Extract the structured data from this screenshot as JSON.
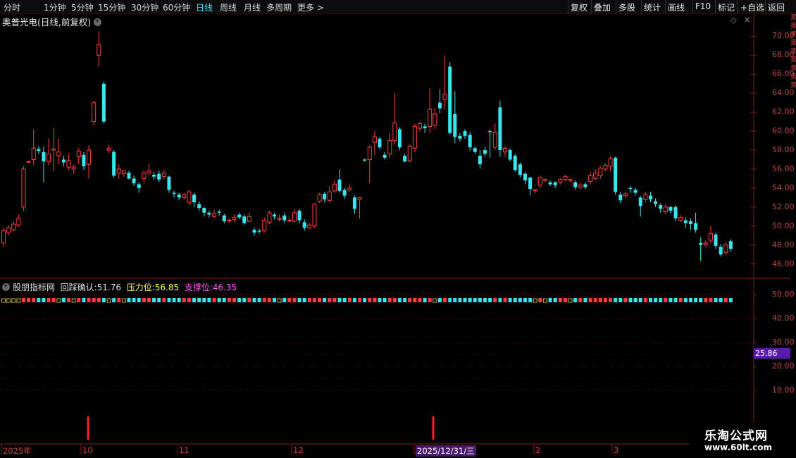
{
  "toolbar": {
    "timeframes": [
      "分时",
      "1分钟",
      "5分钟",
      "15分钟",
      "30分钟",
      "60分钟",
      "日线",
      "周线",
      "月线",
      "多周期",
      "更多 >"
    ],
    "active_index": 6,
    "right_buttons": [
      "复权",
      "叠加",
      "多股",
      "统计",
      "画线",
      "F10",
      "标记",
      "+自选",
      "返回"
    ]
  },
  "main_chart": {
    "title": "奥普光电(日线,前复权)",
    "y_ticks": [
      "70.00",
      "68.00",
      "66.00",
      "64.00",
      "62.00",
      "60.00",
      "58.00",
      "56.00",
      "54.00",
      "52.00",
      "50.00",
      "48.00",
      "46.00"
    ],
    "y_min": 45.0,
    "y_max": 71.0
  },
  "indicator": {
    "name": "股朋指标网",
    "items": [
      {
        "label": "回踩确认:",
        "value": "51.76",
        "color": "#dcdcdc"
      },
      {
        "label": "压力位:",
        "value": "56.85",
        "color": "#ffff55"
      },
      {
        "label": "支撑位:",
        "value": "46.35",
        "color": "#ff55ff"
      }
    ],
    "y_ticks": [
      "50.00",
      "40.00",
      "30.00",
      "20.00",
      "10.00"
    ],
    "current_value_tag": "25.86"
  },
  "x_axis": {
    "labels": [
      "2025年",
      "10",
      "11",
      "12",
      "2025/12/31/三",
      "2",
      "3"
    ],
    "highlight_index": 4
  },
  "watermark": {
    "line1": "乐淘公式网",
    "line2": "www.60lt.com"
  },
  "right_strip_text": "奥奥奥奥奥奥奥奥奥",
  "chart_data": {
    "type": "candlestick",
    "title": "奥普光电(日线,前复权)",
    "ylim": [
      45.0,
      71.0
    ],
    "candles": [
      [
        48.2,
        49.5,
        47.8,
        49.8
      ],
      [
        49.3,
        49.8,
        49.0,
        50.1
      ],
      [
        49.6,
        50.2,
        49.4,
        50.5
      ],
      [
        50.1,
        50.8,
        49.9,
        51.2
      ],
      [
        52.0,
        56.0,
        51.6,
        56.3
      ],
      [
        56.8,
        56.8,
        56.6,
        56.9
      ],
      [
        57.0,
        58.2,
        56.4,
        60.2
      ],
      [
        58.1,
        57.9,
        57.6,
        58.4
      ],
      [
        57.8,
        56.8,
        54.6,
        58.4
      ],
      [
        56.8,
        57.6,
        56.4,
        59.2
      ],
      [
        58.0,
        58.1,
        55.8,
        60.3
      ],
      [
        57.4,
        57.8,
        56.5,
        59.2
      ],
      [
        57.0,
        56.7,
        56.3,
        57.4
      ],
      [
        56.2,
        56.9,
        55.9,
        57.6
      ],
      [
        56.0,
        56.2,
        55.5,
        56.5
      ],
      [
        57.3,
        57.9,
        56.5,
        58.2
      ],
      [
        57.5,
        56.3,
        55.9,
        57.8
      ],
      [
        56.5,
        58.0,
        55.0,
        58.5
      ],
      [
        61.0,
        63.0,
        60.6,
        63.2
      ],
      [
        68.0,
        69.1,
        66.8,
        70.5
      ],
      [
        65.0,
        61.0,
        60.8,
        65.2
      ],
      [
        58.0,
        58.2,
        57.7,
        58.6
      ],
      [
        57.8,
        55.3,
        55.1,
        58.0
      ],
      [
        55.6,
        56.0,
        55.0,
        56.5
      ],
      [
        55.5,
        55.8,
        55.2,
        55.9
      ],
      [
        55.6,
        55.0,
        54.9,
        55.8
      ],
      [
        55.0,
        54.5,
        54.2,
        55.3
      ],
      [
        54.4,
        54.0,
        53.5,
        54.6
      ],
      [
        55.0,
        55.6,
        54.5,
        55.8
      ],
      [
        55.6,
        55.8,
        55.3,
        56.6
      ],
      [
        55.4,
        55.2,
        54.9,
        55.7
      ],
      [
        55.5,
        54.9,
        54.6,
        55.8
      ],
      [
        55.2,
        55.6,
        54.9,
        55.9
      ],
      [
        55.2,
        53.8,
        53.5,
        55.3
      ],
      [
        53.5,
        53.4,
        53.0,
        53.7
      ],
      [
        53.3,
        53.0,
        52.7,
        53.5
      ],
      [
        53.0,
        53.3,
        52.8,
        53.5
      ],
      [
        52.5,
        53.6,
        52.2,
        53.8
      ],
      [
        53.3,
        52.5,
        52.0,
        53.5
      ],
      [
        52.3,
        51.9,
        51.6,
        52.6
      ],
      [
        51.9,
        51.4,
        51.0,
        52.0
      ],
      [
        51.4,
        51.2,
        50.9,
        51.6
      ],
      [
        51.0,
        51.3,
        50.8,
        51.7
      ],
      [
        51.5,
        51.4,
        51.1,
        51.7
      ],
      [
        51.1,
        50.5,
        50.3,
        51.3
      ],
      [
        50.6,
        50.6,
        50.3,
        50.8
      ],
      [
        50.7,
        50.9,
        50.4,
        51.2
      ],
      [
        51.2,
        50.9,
        50.7,
        51.4
      ],
      [
        51.0,
        50.3,
        50.1,
        51.2
      ],
      [
        50.5,
        51.0,
        50.4,
        51.4
      ],
      [
        49.6,
        49.3,
        49.0,
        49.8
      ],
      [
        49.5,
        49.4,
        49.2,
        49.7
      ],
      [
        49.5,
        50.6,
        49.3,
        50.9
      ],
      [
        50.4,
        51.4,
        50.2,
        51.6
      ],
      [
        51.2,
        51.0,
        50.7,
        51.4
      ],
      [
        50.7,
        50.8,
        50.5,
        51.2
      ],
      [
        51.1,
        50.6,
        50.3,
        51.4
      ],
      [
        50.6,
        50.6,
        50.4,
        50.9
      ],
      [
        50.5,
        51.4,
        50.3,
        51.8
      ],
      [
        51.6,
        50.6,
        50.3,
        51.8
      ],
      [
        50.4,
        49.8,
        49.5,
        50.7
      ],
      [
        49.8,
        50.1,
        49.7,
        50.3
      ],
      [
        50.0,
        52.3,
        49.8,
        52.4
      ],
      [
        52.6,
        53.3,
        52.4,
        53.5
      ],
      [
        53.4,
        52.8,
        52.5,
        53.6
      ],
      [
        52.7,
        53.6,
        52.5,
        54.2
      ],
      [
        53.7,
        54.4,
        53.5,
        54.8
      ],
      [
        54.9,
        53.7,
        53.5,
        56.0
      ],
      [
        53.8,
        53.2,
        52.9,
        54.0
      ],
      [
        53.8,
        54.0,
        53.6,
        54.4
      ],
      [
        53.0,
        51.8,
        51.3,
        53.2
      ],
      [
        52.8,
        53.0,
        50.8,
        53.0
      ],
      [
        57.0,
        56.9,
        56.8,
        57.1
      ],
      [
        57.0,
        58.3,
        54.5,
        58.5
      ],
      [
        58.8,
        59.4,
        57.5,
        60.0
      ],
      [
        59.2,
        58.3,
        58.1,
        59.4
      ],
      [
        57.5,
        57.2,
        57.0,
        57.8
      ],
      [
        57.6,
        59.0,
        57.2,
        59.8
      ],
      [
        59.0,
        60.9,
        58.6,
        64.0
      ],
      [
        60.2,
        58.3,
        58.0,
        60.4
      ],
      [
        57.4,
        56.8,
        56.7,
        57.6
      ],
      [
        56.9,
        58.4,
        56.7,
        58.6
      ],
      [
        58.2,
        60.5,
        57.8,
        60.8
      ],
      [
        60.3,
        60.8,
        60.0,
        61.0
      ],
      [
        60.5,
        60.3,
        59.8,
        60.8
      ],
      [
        60.5,
        62.3,
        59.8,
        64.5
      ],
      [
        60.6,
        61.8,
        60.2,
        62.4
      ],
      [
        63.0,
        62.4,
        61.9,
        64.4
      ],
      [
        63.3,
        63.9,
        62.3,
        68.0
      ],
      [
        66.8,
        59.8,
        59.6,
        67.3
      ],
      [
        61.8,
        59.4,
        58.7,
        64.2
      ],
      [
        59.5,
        59.2,
        58.9,
        59.8
      ],
      [
        60.0,
        59.5,
        59.2,
        60.2
      ],
      [
        59.6,
        58.3,
        57.9,
        59.9
      ],
      [
        58.2,
        57.8,
        57.6,
        58.4
      ],
      [
        57.4,
        56.5,
        56.1,
        58.0
      ],
      [
        58.0,
        57.6,
        57.3,
        58.3
      ],
      [
        60.0,
        59.9,
        57.2,
        60.2
      ],
      [
        58.3,
        59.9,
        58.0,
        60.8
      ],
      [
        62.5,
        58.0,
        57.3,
        63.2
      ],
      [
        57.8,
        58.2,
        57.3,
        58.4
      ],
      [
        58.0,
        57.0,
        56.8,
        58.2
      ],
      [
        57.4,
        55.9,
        55.7,
        57.6
      ],
      [
        56.5,
        55.4,
        55.1,
        56.7
      ],
      [
        55.5,
        54.8,
        54.4,
        55.7
      ],
      [
        55.1,
        53.9,
        53.2,
        55.2
      ],
      [
        53.7,
        53.8,
        53.4,
        53.9
      ],
      [
        54.3,
        55.1,
        54.0,
        55.3
      ],
      [
        54.8,
        54.9,
        54.6,
        55.0
      ],
      [
        54.6,
        54.4,
        54.2,
        54.8
      ],
      [
        54.6,
        54.3,
        54.0,
        54.7
      ],
      [
        54.6,
        54.9,
        54.4,
        55.1
      ],
      [
        54.9,
        55.2,
        54.7,
        55.4
      ],
      [
        54.8,
        54.9,
        54.6,
        55.0
      ],
      [
        54.6,
        54.1,
        53.8,
        54.8
      ],
      [
        54.1,
        54.3,
        53.9,
        54.6
      ],
      [
        54.4,
        54.1,
        53.9,
        54.6
      ],
      [
        54.7,
        55.3,
        54.4,
        55.7
      ],
      [
        55.0,
        55.6,
        54.8,
        56.0
      ],
      [
        55.3,
        56.1,
        55.0,
        56.3
      ],
      [
        56.0,
        56.4,
        55.8,
        56.6
      ],
      [
        56.3,
        57.1,
        55.8,
        57.4
      ],
      [
        57.2,
        53.6,
        53.3,
        57.3
      ],
      [
        53.3,
        52.7,
        52.4,
        53.6
      ],
      [
        53.2,
        53.4,
        52.9,
        53.6
      ],
      [
        54.0,
        53.9,
        53.5,
        54.2
      ],
      [
        53.8,
        53.5,
        53.2,
        54.0
      ],
      [
        53.0,
        52.1,
        51.0,
        53.2
      ],
      [
        52.8,
        53.3,
        52.5,
        53.6
      ],
      [
        53.2,
        52.8,
        52.5,
        53.6
      ],
      [
        52.6,
        52.3,
        52.0,
        52.9
      ],
      [
        52.2,
        51.8,
        51.4,
        52.4
      ],
      [
        51.5,
        52.0,
        51.2,
        52.3
      ],
      [
        52.0,
        51.6,
        51.3,
        52.1
      ],
      [
        52.0,
        50.8,
        50.5,
        52.2
      ],
      [
        50.6,
        50.9,
        50.4,
        51.1
      ],
      [
        50.6,
        50.3,
        49.8,
        50.9
      ],
      [
        50.5,
        50.2,
        49.6,
        50.8
      ],
      [
        50.3,
        49.6,
        49.3,
        51.4
      ],
      [
        48.2,
        48.0,
        46.3,
        48.8
      ],
      [
        48.0,
        48.2,
        47.8,
        48.5
      ],
      [
        48.5,
        49.2,
        48.2,
        50.0
      ],
      [
        49.1,
        47.9,
        47.6,
        49.3
      ],
      [
        47.8,
        47.0,
        46.8,
        48.1
      ],
      [
        47.2,
        48.0,
        46.9,
        48.3
      ],
      [
        48.4,
        47.6,
        47.3,
        48.6
      ]
    ],
    "indicator_levels": [
      1,
      1,
      1,
      1,
      2,
      2,
      2,
      2,
      2,
      3,
      3,
      3,
      3,
      3,
      3,
      3,
      3,
      3,
      3,
      3,
      3,
      3,
      3,
      3,
      3,
      3,
      3,
      3,
      3,
      3,
      3,
      3,
      3,
      3,
      3,
      3,
      3,
      3,
      3,
      3,
      3,
      3,
      3,
      3,
      3,
      3,
      3,
      3,
      3,
      3,
      3,
      3,
      3,
      3,
      3,
      3,
      3,
      3,
      3,
      3,
      3,
      3,
      3,
      3,
      3,
      3,
      3,
      3,
      3,
      3,
      3,
      3,
      3,
      3,
      3,
      3,
      3,
      3,
      3,
      3,
      3,
      3,
      3,
      3,
      3,
      3,
      3,
      3,
      3,
      3,
      3,
      3,
      3,
      3,
      3,
      3,
      3,
      3,
      3,
      3,
      3,
      3,
      3,
      3,
      3,
      3,
      3,
      3,
      3,
      3,
      3,
      3,
      3,
      3,
      3,
      3,
      3,
      3,
      3,
      3,
      3,
      3,
      3,
      3,
      3,
      3,
      3,
      3,
      3,
      3,
      3,
      3,
      3,
      3,
      3,
      3,
      3,
      3,
      3,
      3,
      3,
      3,
      3,
      3,
      3
    ],
    "signal_marks": [
      "10",
      "2025/12/31/三"
    ]
  }
}
